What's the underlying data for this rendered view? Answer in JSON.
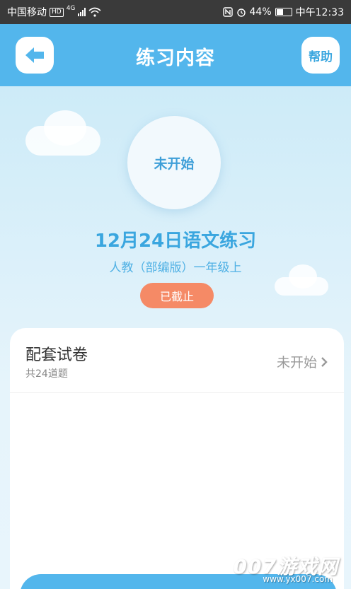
{
  "status_bar": {
    "carrier": "中国移动",
    "hd_badge": "HD",
    "net_type": "4G",
    "battery": "44%",
    "time": "中午12:33"
  },
  "nav": {
    "title": "练习内容",
    "help_label": "帮助"
  },
  "exercise": {
    "progress_state": "未开始",
    "title": "12月24日语文练习",
    "subtitle": "人教（部编版）一年级上",
    "deadline_status": "已截止"
  },
  "card": {
    "item_title": "配套试卷",
    "item_count": "共24道题",
    "item_status": "未开始"
  },
  "watermark": {
    "brand": "007游戏网",
    "url": "www.yx007.com"
  },
  "colors": {
    "header": "#53b6ec",
    "accent": "#3aa6df",
    "pill": "#f58a66"
  }
}
